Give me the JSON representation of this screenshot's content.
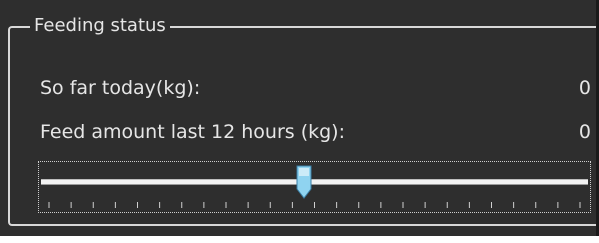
{
  "group": {
    "title": "Feeding status"
  },
  "rows": [
    {
      "label": "So far today(kg):",
      "value": "0"
    },
    {
      "label": "Feed amount last 12 hours (kg):",
      "value": "0"
    }
  ],
  "slider": {
    "value_fraction": 0.48,
    "tick_count": 25
  },
  "colors": {
    "panel_bg": "#2e2e2e",
    "text": "#e6e6e6",
    "thumb_fill": "#8fd3f0",
    "thumb_stroke": "#3a7fa6"
  }
}
